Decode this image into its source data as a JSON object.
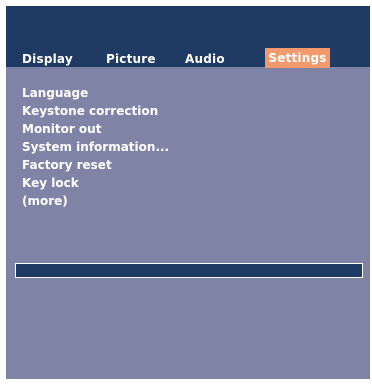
{
  "tabs": [
    {
      "label": "Display"
    },
    {
      "label": "Picture"
    },
    {
      "label": "Audio"
    },
    {
      "label": "Settings",
      "active": true
    }
  ],
  "menu": {
    "items": [
      {
        "label": "Language"
      },
      {
        "label": "Keystone correction"
      },
      {
        "label": "Monitor out"
      },
      {
        "label": "System information..."
      },
      {
        "label": "Factory reset"
      },
      {
        "label": "Key lock"
      },
      {
        "label": "(more)"
      }
    ]
  },
  "colors": {
    "panel_background": "#7f84a6",
    "header_background": "#1f3b63",
    "active_tab": "#f29a6b",
    "text": "#ffffff"
  }
}
